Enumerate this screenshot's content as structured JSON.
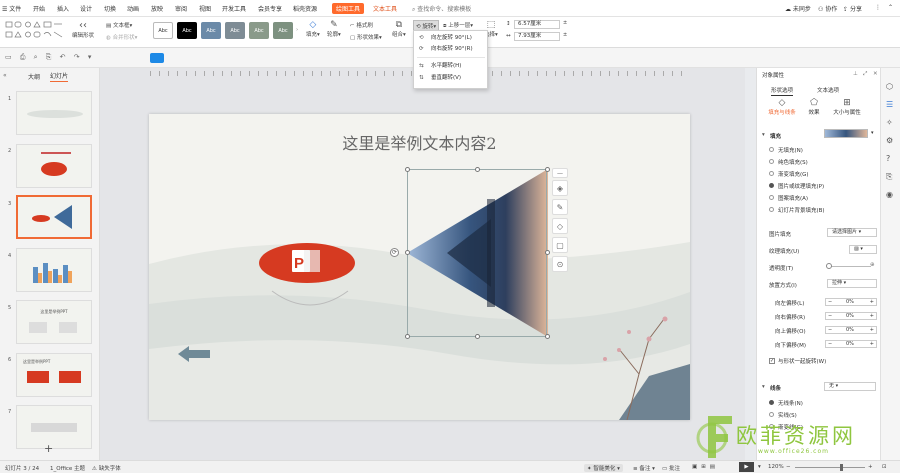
{
  "menubar": {
    "file_icon_label": "文件",
    "items": [
      "开始",
      "插入",
      "设计",
      "切换",
      "动画",
      "放映",
      "审阅",
      "视图",
      "开发工具",
      "会员专享",
      "稻壳资源"
    ],
    "context_tab_picture": "绘图工具",
    "context_tab_text": "文本工具",
    "search_placeholder": "查找命令、搜索模板",
    "sync_label": "未同步",
    "collab_label": "协作",
    "share_label": "分享"
  },
  "ribbon": {
    "edit_shape": "编辑形状",
    "text_box": "文本框",
    "merge_shape": "合并形状",
    "style_labels": [
      "Abc",
      "Abc",
      "Abc",
      "Abc",
      "Abc",
      "Abc"
    ],
    "fill_label": "填充",
    "outline_label": "轮廓",
    "format_painter": "格式刷",
    "shape_effect": "形状效果",
    "group_label": "组合",
    "rotate_label": "旋转",
    "bring_forward": "上移一层",
    "select_label": "选择",
    "height_value": "6.57厘米",
    "width_value": "7.93厘米"
  },
  "rotate_menu": {
    "items": [
      "向左旋转 90°(L)",
      "向右旋转 90°(R)",
      "水平翻转(H)",
      "垂直翻转(V)"
    ]
  },
  "leftpanel": {
    "tab_outline": "大纲",
    "tab_slides": "幻灯片",
    "slide_numbers": [
      "1",
      "2",
      "3",
      "4",
      "5",
      "6",
      "7"
    ],
    "thumb5_title": "这里是举例PPT",
    "thumb6_title": "这里是举例PPT",
    "add_slide": "+"
  },
  "slide": {
    "title": "这里是举例文本内容2"
  },
  "rightpanel": {
    "title": "对象属性",
    "tab_shape": "形状选项",
    "tab_text": "文本选项",
    "subtab_fill_line": "填充与线条",
    "subtab_effect": "效果",
    "subtab_size": "大小与属性",
    "section_fill": "填充",
    "fill_options": [
      "无填充(N)",
      "纯色填充(S)",
      "渐变填充(G)",
      "图片或纹理填充(P)",
      "图案填充(A)",
      "幻灯片背景填充(B)"
    ],
    "fill_selected_index": 3,
    "picture_fill_label": "图片填充",
    "picture_fill_value": "请选择图片",
    "texture_fill_label": "纹理填充(U)",
    "transparency_label": "透明度(T)",
    "transparency_value": "0%",
    "placement_label": "放置方式(I)",
    "placement_value": "拉伸",
    "offset_left_label": "向左偏移(L)",
    "offset_right_label": "向右偏移(R)",
    "offset_up_label": "向上偏移(O)",
    "offset_down_label": "向下偏移(M)",
    "offset_value": "0%",
    "rotate_with_shape": "与形状一起旋转(W)",
    "section_line": "线条",
    "line_value": "无",
    "line_options": [
      "无线条(N)",
      "实线(S)",
      "渐变线(G)"
    ],
    "line_selected_index": 0
  },
  "statusbar": {
    "slide_info": "幻灯片 3 / 24",
    "theme": "1_Office 主题",
    "missing_font": "缺失字体",
    "smart_beautify": "智能美化",
    "notes": "备注",
    "comments": "批注",
    "zoom": "120%"
  },
  "watermark": {
    "text_cn": "欧菲资源网",
    "text_url": "www.office26.com"
  },
  "colors": {
    "accent": "#ff6a2c",
    "slide_red": "#d63a21",
    "arrow_gray": "#6f8a97",
    "watermark": "#8fc63f"
  }
}
